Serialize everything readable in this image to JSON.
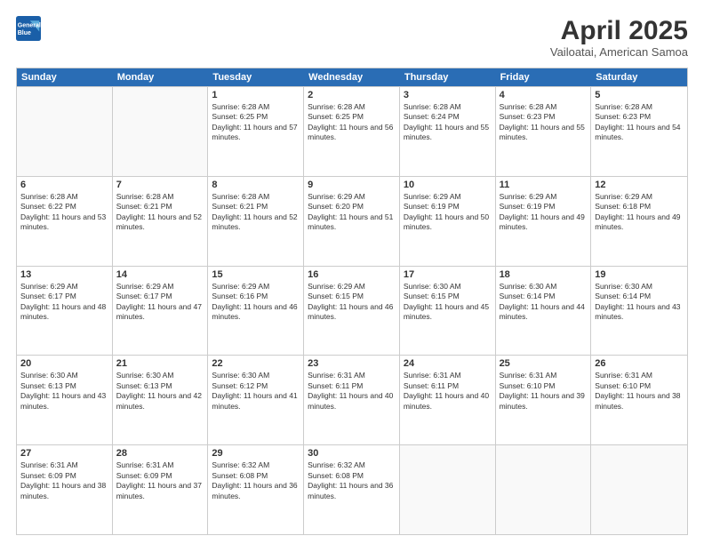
{
  "header": {
    "logo_line1": "General",
    "logo_line2": "Blue",
    "title": "April 2025",
    "subtitle": "Vailoatai, American Samoa"
  },
  "days_of_week": [
    "Sunday",
    "Monday",
    "Tuesday",
    "Wednesday",
    "Thursday",
    "Friday",
    "Saturday"
  ],
  "weeks": [
    [
      {
        "num": "",
        "empty": true
      },
      {
        "num": "",
        "empty": true
      },
      {
        "num": "1",
        "sunrise": "6:28 AM",
        "sunset": "6:25 PM",
        "daylight": "11 hours and 57 minutes."
      },
      {
        "num": "2",
        "sunrise": "6:28 AM",
        "sunset": "6:25 PM",
        "daylight": "11 hours and 56 minutes."
      },
      {
        "num": "3",
        "sunrise": "6:28 AM",
        "sunset": "6:24 PM",
        "daylight": "11 hours and 55 minutes."
      },
      {
        "num": "4",
        "sunrise": "6:28 AM",
        "sunset": "6:23 PM",
        "daylight": "11 hours and 55 minutes."
      },
      {
        "num": "5",
        "sunrise": "6:28 AM",
        "sunset": "6:23 PM",
        "daylight": "11 hours and 54 minutes."
      }
    ],
    [
      {
        "num": "6",
        "sunrise": "6:28 AM",
        "sunset": "6:22 PM",
        "daylight": "11 hours and 53 minutes."
      },
      {
        "num": "7",
        "sunrise": "6:28 AM",
        "sunset": "6:21 PM",
        "daylight": "11 hours and 52 minutes."
      },
      {
        "num": "8",
        "sunrise": "6:28 AM",
        "sunset": "6:21 PM",
        "daylight": "11 hours and 52 minutes."
      },
      {
        "num": "9",
        "sunrise": "6:29 AM",
        "sunset": "6:20 PM",
        "daylight": "11 hours and 51 minutes."
      },
      {
        "num": "10",
        "sunrise": "6:29 AM",
        "sunset": "6:19 PM",
        "daylight": "11 hours and 50 minutes."
      },
      {
        "num": "11",
        "sunrise": "6:29 AM",
        "sunset": "6:19 PM",
        "daylight": "11 hours and 49 minutes."
      },
      {
        "num": "12",
        "sunrise": "6:29 AM",
        "sunset": "6:18 PM",
        "daylight": "11 hours and 49 minutes."
      }
    ],
    [
      {
        "num": "13",
        "sunrise": "6:29 AM",
        "sunset": "6:17 PM",
        "daylight": "11 hours and 48 minutes."
      },
      {
        "num": "14",
        "sunrise": "6:29 AM",
        "sunset": "6:17 PM",
        "daylight": "11 hours and 47 minutes."
      },
      {
        "num": "15",
        "sunrise": "6:29 AM",
        "sunset": "6:16 PM",
        "daylight": "11 hours and 46 minutes."
      },
      {
        "num": "16",
        "sunrise": "6:29 AM",
        "sunset": "6:15 PM",
        "daylight": "11 hours and 46 minutes."
      },
      {
        "num": "17",
        "sunrise": "6:30 AM",
        "sunset": "6:15 PM",
        "daylight": "11 hours and 45 minutes."
      },
      {
        "num": "18",
        "sunrise": "6:30 AM",
        "sunset": "6:14 PM",
        "daylight": "11 hours and 44 minutes."
      },
      {
        "num": "19",
        "sunrise": "6:30 AM",
        "sunset": "6:14 PM",
        "daylight": "11 hours and 43 minutes."
      }
    ],
    [
      {
        "num": "20",
        "sunrise": "6:30 AM",
        "sunset": "6:13 PM",
        "daylight": "11 hours and 43 minutes."
      },
      {
        "num": "21",
        "sunrise": "6:30 AM",
        "sunset": "6:13 PM",
        "daylight": "11 hours and 42 minutes."
      },
      {
        "num": "22",
        "sunrise": "6:30 AM",
        "sunset": "6:12 PM",
        "daylight": "11 hours and 41 minutes."
      },
      {
        "num": "23",
        "sunrise": "6:31 AM",
        "sunset": "6:11 PM",
        "daylight": "11 hours and 40 minutes."
      },
      {
        "num": "24",
        "sunrise": "6:31 AM",
        "sunset": "6:11 PM",
        "daylight": "11 hours and 40 minutes."
      },
      {
        "num": "25",
        "sunrise": "6:31 AM",
        "sunset": "6:10 PM",
        "daylight": "11 hours and 39 minutes."
      },
      {
        "num": "26",
        "sunrise": "6:31 AM",
        "sunset": "6:10 PM",
        "daylight": "11 hours and 38 minutes."
      }
    ],
    [
      {
        "num": "27",
        "sunrise": "6:31 AM",
        "sunset": "6:09 PM",
        "daylight": "11 hours and 38 minutes."
      },
      {
        "num": "28",
        "sunrise": "6:31 AM",
        "sunset": "6:09 PM",
        "daylight": "11 hours and 37 minutes."
      },
      {
        "num": "29",
        "sunrise": "6:32 AM",
        "sunset": "6:08 PM",
        "daylight": "11 hours and 36 minutes."
      },
      {
        "num": "30",
        "sunrise": "6:32 AM",
        "sunset": "6:08 PM",
        "daylight": "11 hours and 36 minutes."
      },
      {
        "num": "",
        "empty": true
      },
      {
        "num": "",
        "empty": true
      },
      {
        "num": "",
        "empty": true
      }
    ]
  ]
}
